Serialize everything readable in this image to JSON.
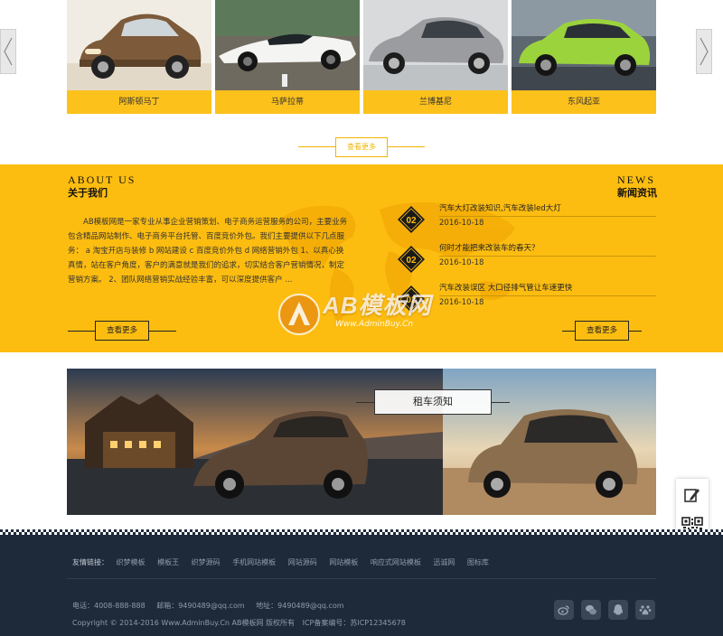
{
  "carousel": {
    "cars": [
      {
        "name": "阿斯顿马丁"
      },
      {
        "name": "马萨拉蒂"
      },
      {
        "name": "兰博基尼"
      },
      {
        "name": "东风起亚"
      }
    ]
  },
  "more_top_label": "查看更多",
  "about": {
    "title_en": "ABOUT US",
    "title_cn": "关于我们",
    "text": "AB模板网是一家专业从事企业营销策划、电子商务运营服务的公司，主要业务包含精品网站制作、电子商务平台托管、百度竞价外包。我们主要提供以下几点服务： a 淘宝开店与装修 b 网站建设 c 百度竞价外包 d 网络营销外包 1、以真心换真情，站在客户角度，客户的满意就是我们的追求，切实结合客户营销情况，制定营销方案。 2、团队网络营销实战经验丰富，可以深度提供客户 ...",
    "more_label": "查看更多"
  },
  "news": {
    "title_en": "NEWS",
    "title_cn": "新闻资讯",
    "more_label": "查看更多",
    "items": [
      {
        "day": "02",
        "title": "汽车大灯改装知识,汽车改装led大灯",
        "date": "2016-10-18"
      },
      {
        "day": "02",
        "title": "何时才能把来改装车的春天？",
        "date": "2016-10-18"
      },
      {
        "day": "02",
        "title": "汽车改装误区 大口径排气管让车速更快",
        "date": "2016-10-18"
      }
    ]
  },
  "watermark": {
    "text": "AB模板网",
    "url": "Www.AdminBuy.Cn"
  },
  "rental": {
    "label": "租车须知"
  },
  "footer": {
    "links_label": "友情链接：",
    "links": [
      "织梦模板",
      "模板王",
      "织梦源码",
      "手机网站模板",
      "网站源码",
      "网站模板",
      "响应式网站模板",
      "迅诚网",
      "图标库"
    ],
    "phone": "电话：4008-888-888",
    "email": "邮箱：9490489@qq.com",
    "address": "地址：9490489@qq.com",
    "copyright": "Copyright © 2014-2016 Www.AdminBuy.Cn AB模板网 版权所有",
    "icp": "ICP备案编号：苏ICP12345678"
  },
  "colors": {
    "accent": "#fdbd10",
    "footer_bg": "#1e2a3a",
    "card_label_bg": "#fcc11b"
  },
  "icons": [
    "chevron-left-icon",
    "chevron-right-icon",
    "edit-icon",
    "qrcode-icon",
    "weibo-icon",
    "wechat-icon",
    "qq-icon",
    "baidu-icon"
  ]
}
